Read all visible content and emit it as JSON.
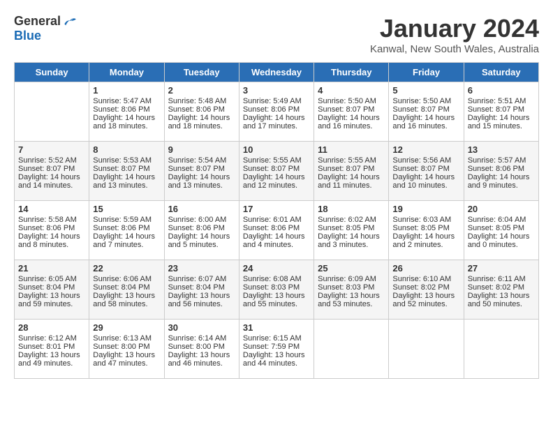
{
  "header": {
    "logo_general": "General",
    "logo_blue": "Blue",
    "month": "January 2024",
    "location": "Kanwal, New South Wales, Australia"
  },
  "weekdays": [
    "Sunday",
    "Monday",
    "Tuesday",
    "Wednesday",
    "Thursday",
    "Friday",
    "Saturday"
  ],
  "weeks": [
    [
      {
        "day": "",
        "info": ""
      },
      {
        "day": "1",
        "info": "Sunrise: 5:47 AM\nSunset: 8:06 PM\nDaylight: 14 hours\nand 18 minutes."
      },
      {
        "day": "2",
        "info": "Sunrise: 5:48 AM\nSunset: 8:06 PM\nDaylight: 14 hours\nand 18 minutes."
      },
      {
        "day": "3",
        "info": "Sunrise: 5:49 AM\nSunset: 8:06 PM\nDaylight: 14 hours\nand 17 minutes."
      },
      {
        "day": "4",
        "info": "Sunrise: 5:50 AM\nSunset: 8:07 PM\nDaylight: 14 hours\nand 16 minutes."
      },
      {
        "day": "5",
        "info": "Sunrise: 5:50 AM\nSunset: 8:07 PM\nDaylight: 14 hours\nand 16 minutes."
      },
      {
        "day": "6",
        "info": "Sunrise: 5:51 AM\nSunset: 8:07 PM\nDaylight: 14 hours\nand 15 minutes."
      }
    ],
    [
      {
        "day": "7",
        "info": "Sunrise: 5:52 AM\nSunset: 8:07 PM\nDaylight: 14 hours\nand 14 minutes."
      },
      {
        "day": "8",
        "info": "Sunrise: 5:53 AM\nSunset: 8:07 PM\nDaylight: 14 hours\nand 13 minutes."
      },
      {
        "day": "9",
        "info": "Sunrise: 5:54 AM\nSunset: 8:07 PM\nDaylight: 14 hours\nand 13 minutes."
      },
      {
        "day": "10",
        "info": "Sunrise: 5:55 AM\nSunset: 8:07 PM\nDaylight: 14 hours\nand 12 minutes."
      },
      {
        "day": "11",
        "info": "Sunrise: 5:55 AM\nSunset: 8:07 PM\nDaylight: 14 hours\nand 11 minutes."
      },
      {
        "day": "12",
        "info": "Sunrise: 5:56 AM\nSunset: 8:07 PM\nDaylight: 14 hours\nand 10 minutes."
      },
      {
        "day": "13",
        "info": "Sunrise: 5:57 AM\nSunset: 8:06 PM\nDaylight: 14 hours\nand 9 minutes."
      }
    ],
    [
      {
        "day": "14",
        "info": "Sunrise: 5:58 AM\nSunset: 8:06 PM\nDaylight: 14 hours\nand 8 minutes."
      },
      {
        "day": "15",
        "info": "Sunrise: 5:59 AM\nSunset: 8:06 PM\nDaylight: 14 hours\nand 7 minutes."
      },
      {
        "day": "16",
        "info": "Sunrise: 6:00 AM\nSunset: 8:06 PM\nDaylight: 14 hours\nand 5 minutes."
      },
      {
        "day": "17",
        "info": "Sunrise: 6:01 AM\nSunset: 8:06 PM\nDaylight: 14 hours\nand 4 minutes."
      },
      {
        "day": "18",
        "info": "Sunrise: 6:02 AM\nSunset: 8:05 PM\nDaylight: 14 hours\nand 3 minutes."
      },
      {
        "day": "19",
        "info": "Sunrise: 6:03 AM\nSunset: 8:05 PM\nDaylight: 14 hours\nand 2 minutes."
      },
      {
        "day": "20",
        "info": "Sunrise: 6:04 AM\nSunset: 8:05 PM\nDaylight: 14 hours\nand 0 minutes."
      }
    ],
    [
      {
        "day": "21",
        "info": "Sunrise: 6:05 AM\nSunset: 8:04 PM\nDaylight: 13 hours\nand 59 minutes."
      },
      {
        "day": "22",
        "info": "Sunrise: 6:06 AM\nSunset: 8:04 PM\nDaylight: 13 hours\nand 58 minutes."
      },
      {
        "day": "23",
        "info": "Sunrise: 6:07 AM\nSunset: 8:04 PM\nDaylight: 13 hours\nand 56 minutes."
      },
      {
        "day": "24",
        "info": "Sunrise: 6:08 AM\nSunset: 8:03 PM\nDaylight: 13 hours\nand 55 minutes."
      },
      {
        "day": "25",
        "info": "Sunrise: 6:09 AM\nSunset: 8:03 PM\nDaylight: 13 hours\nand 53 minutes."
      },
      {
        "day": "26",
        "info": "Sunrise: 6:10 AM\nSunset: 8:02 PM\nDaylight: 13 hours\nand 52 minutes."
      },
      {
        "day": "27",
        "info": "Sunrise: 6:11 AM\nSunset: 8:02 PM\nDaylight: 13 hours\nand 50 minutes."
      }
    ],
    [
      {
        "day": "28",
        "info": "Sunrise: 6:12 AM\nSunset: 8:01 PM\nDaylight: 13 hours\nand 49 minutes."
      },
      {
        "day": "29",
        "info": "Sunrise: 6:13 AM\nSunset: 8:00 PM\nDaylight: 13 hours\nand 47 minutes."
      },
      {
        "day": "30",
        "info": "Sunrise: 6:14 AM\nSunset: 8:00 PM\nDaylight: 13 hours\nand 46 minutes."
      },
      {
        "day": "31",
        "info": "Sunrise: 6:15 AM\nSunset: 7:59 PM\nDaylight: 13 hours\nand 44 minutes."
      },
      {
        "day": "",
        "info": ""
      },
      {
        "day": "",
        "info": ""
      },
      {
        "day": "",
        "info": ""
      }
    ]
  ]
}
